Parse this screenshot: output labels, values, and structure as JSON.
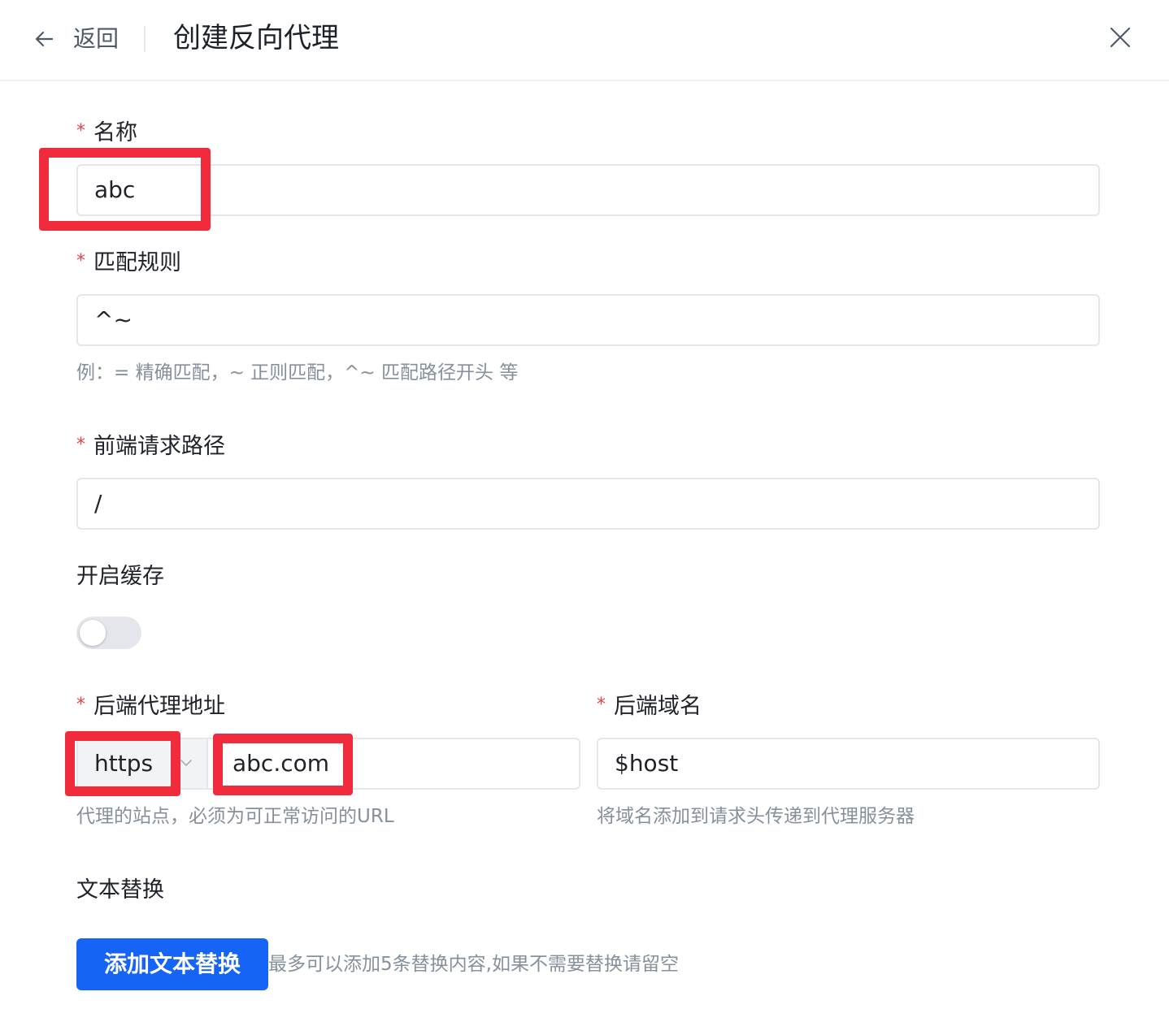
{
  "header": {
    "back_label": "返回",
    "title": "创建反向代理"
  },
  "form": {
    "required_mark": "*",
    "name": {
      "label": "名称",
      "value": "abc"
    },
    "match_rule": {
      "label": "匹配规则",
      "value": "^~",
      "hint": "例：= 精确匹配，~ 正则匹配，^~ 匹配路径开头 等"
    },
    "frontend_path": {
      "label": "前端请求路径",
      "value": "/"
    },
    "cache": {
      "label": "开启缓存",
      "enabled": false
    },
    "backend_address": {
      "label": "后端代理地址",
      "protocol": "https",
      "host": "abc.com",
      "hint": "代理的站点，必须为可正常访问的URL"
    },
    "backend_domain": {
      "label": "后端域名",
      "value": "$host",
      "hint": "将域名添加到请求头传递到代理服务器"
    },
    "text_replace": {
      "label": "文本替换",
      "button_label": "添加文本替换",
      "hint": "最多可以添加5条替换内容,如果不需要替换请留空"
    }
  },
  "colors": {
    "accent": "#1664f5",
    "required": "#f53f3f",
    "highlight": "#ef2b3c"
  }
}
